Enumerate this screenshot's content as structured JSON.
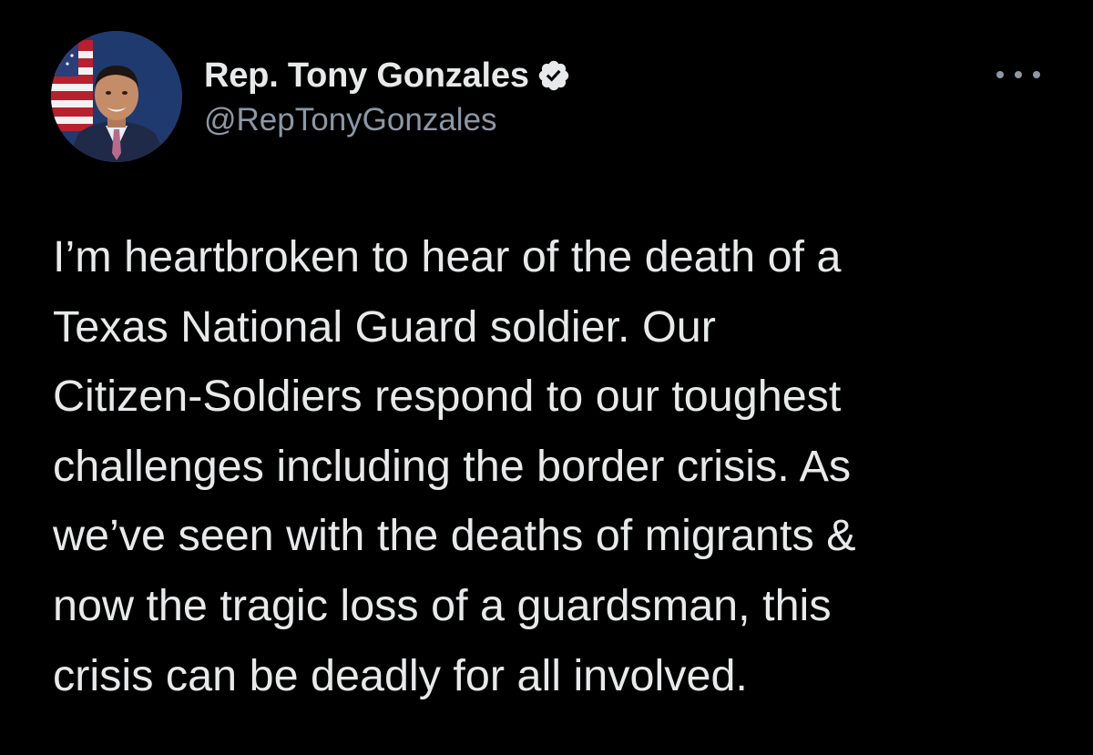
{
  "tweet": {
    "author": {
      "display_name": "Rep. Tony Gonzales",
      "handle": "@RepTonyGonzales",
      "verified_icon": "verified-badge-icon",
      "avatar": "profile-photo"
    },
    "more_icon": "more-options-icon",
    "text_lines": [
      "I’m heartbroken to hear of the death of a",
      "Texas National Guard soldier. Our",
      "Citizen-Soldiers respond to our toughest",
      "challenges including the border crisis. As",
      "we’ve seen with the deaths of migrants &",
      "now the tragic loss of a guardsman, this",
      "crisis can be deadly for all involved."
    ]
  },
  "colors": {
    "background": "#000000",
    "primary_text": "#e7e9ea",
    "secondary_text": "#8b98a5",
    "verified_badge": "#e7e9ea"
  }
}
